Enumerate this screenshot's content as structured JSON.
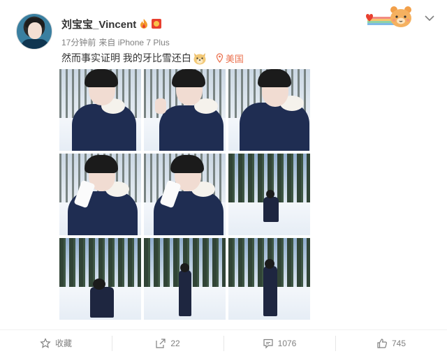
{
  "post": {
    "username": "刘宝宝_Vincent",
    "time": "17分钟前",
    "source": "来自 iPhone 7 Plus",
    "text": "然而事实证明 我的牙比雪还白",
    "location": "美国"
  },
  "icons": {
    "fire": "fire-icon",
    "vip": "vip-badge-icon",
    "emoji": "dog-emoji-icon",
    "pin": "location-pin-icon",
    "chevron": "chevron-down-icon",
    "favorite": "star-icon",
    "repost": "share-icon",
    "comment": "comment-icon",
    "like": "thumbs-up-icon"
  },
  "photos": [
    {
      "scene": "selfie-snow"
    },
    {
      "scene": "selfie-peace-sign"
    },
    {
      "scene": "selfie-closeup"
    },
    {
      "scene": "eating-snow"
    },
    {
      "scene": "eating-snow-2"
    },
    {
      "scene": "crouching-forest"
    },
    {
      "scene": "crouching-near"
    },
    {
      "scene": "standing-forest"
    },
    {
      "scene": "standing-field"
    }
  ],
  "actions": {
    "favorite_label": "收藏",
    "repost_count": "22",
    "comment_count": "1076",
    "like_count": "745"
  },
  "colors": {
    "accent_location": "#eb7350",
    "text_meta": "#808080"
  }
}
